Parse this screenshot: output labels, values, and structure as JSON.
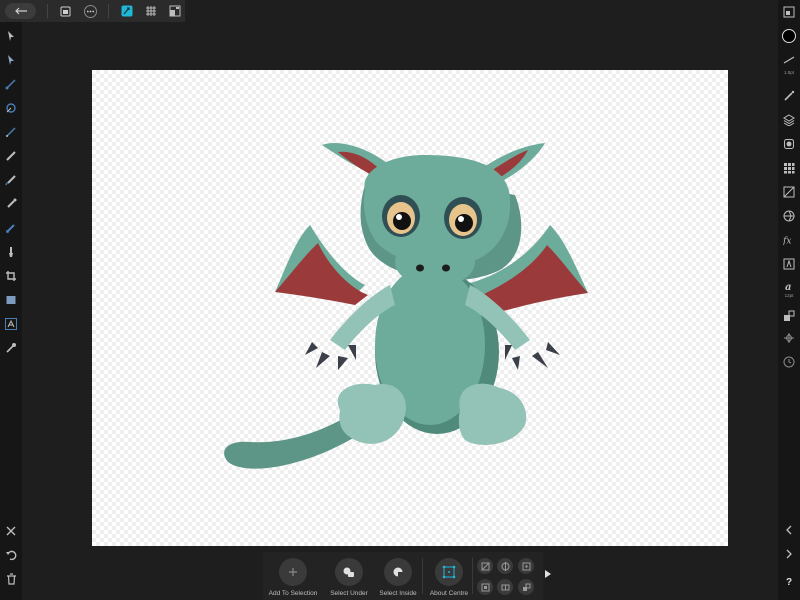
{
  "context_toolbar": {
    "items": [
      {
        "label": "Add To Selection",
        "icon": "plus-icon"
      },
      {
        "label": "Select Under",
        "icon": "select-under-icon"
      },
      {
        "label": "Select Inside",
        "icon": "select-inside-icon"
      },
      {
        "label": "About Centre",
        "icon": "about-centre-icon"
      }
    ]
  },
  "right_panel": {
    "stroke_width": "1.0pt",
    "font_size": "12pt",
    "help": "?"
  },
  "colors": {
    "accent": "#1fb7d6",
    "dragon_body": "#6dab9b",
    "dragon_dark": "#4f8a7b",
    "dragon_light": "#93c3b6",
    "wing_red": "#9a3a3a",
    "eye_gold": "#e7c48b"
  }
}
